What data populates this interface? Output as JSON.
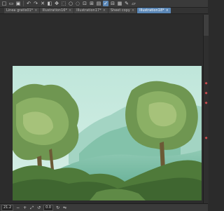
{
  "toolbar": {
    "icons": [
      "new-file-icon",
      "open-icon",
      "save-icon",
      "undo-icon",
      "redo-icon",
      "clear-icon",
      "fill-icon",
      "move-icon",
      "select-icon",
      "lasso-icon",
      "deselect-icon",
      "transform-icon",
      "select-all-icon",
      "layer-icon",
      "settings-icon",
      "grid-icon",
      "ruler-icon",
      "brush-icon",
      "eraser-icon"
    ]
  },
  "tabs": [
    {
      "label": "Linea gratis01*",
      "active": false
    },
    {
      "label": "Illustration16*",
      "active": false
    },
    {
      "label": "Illustration17*",
      "active": false
    },
    {
      "label": "Sheet copy",
      "active": false
    },
    {
      "label": "Illustration18*",
      "active": true
    }
  ],
  "status": {
    "zoom": "21.2",
    "angle": "0.0"
  },
  "colors": {
    "accent": "#5a86b5",
    "sky": "#b9e0d4",
    "foliage": "#4f7a3a"
  }
}
